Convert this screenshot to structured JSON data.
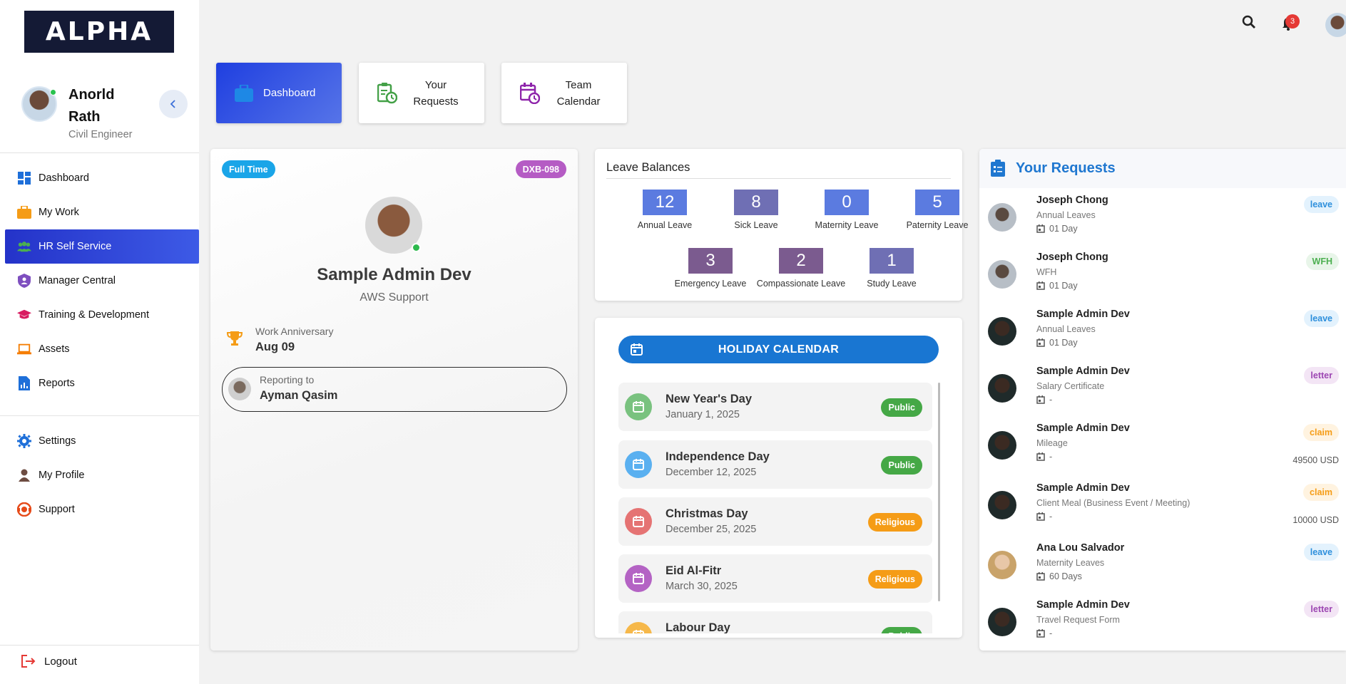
{
  "app": {
    "logo_text": "ALPHA"
  },
  "user": {
    "name": "Anorld Rath",
    "role": "Civil Engineer"
  },
  "sidebar": {
    "items": [
      {
        "label": "Dashboard",
        "icon": "dashboard-icon"
      },
      {
        "label": "My Work",
        "icon": "briefcase-icon"
      },
      {
        "label": "HR Self Service",
        "icon": "people-icon"
      },
      {
        "label": "Manager Central",
        "icon": "shield-icon"
      },
      {
        "label": "Training & Development",
        "icon": "graduation-cap-icon"
      },
      {
        "label": "Assets",
        "icon": "laptop-icon"
      },
      {
        "label": "Reports",
        "icon": "report-icon"
      }
    ],
    "secondary": [
      {
        "label": "Settings",
        "icon": "gear-icon"
      },
      {
        "label": "My Profile",
        "icon": "person-icon"
      },
      {
        "label": "Support",
        "icon": "support-icon"
      }
    ],
    "logout_label": "Logout",
    "active_index": 2
  },
  "topbar": {
    "notification_count": "3"
  },
  "tabs": [
    {
      "label": "Dashboard"
    },
    {
      "label": "Your Requests"
    },
    {
      "label": "Team Calendar"
    }
  ],
  "profile_card": {
    "employment_type": "Full Time",
    "employee_id": "DXB-098",
    "name": "Sample Admin Dev",
    "department": "AWS Support",
    "anniversary_label": "Work Anniversary",
    "anniversary_value": "Aug 09",
    "reporting_label": "Reporting to",
    "reporting_name": "Ayman Qasim"
  },
  "leave_balances": {
    "title": "Leave Balances",
    "items": [
      {
        "value": "12",
        "label": "Annual Leave",
        "color": "#5b7be0"
      },
      {
        "value": "8",
        "label": "Sick Leave",
        "color": "#6f6fb4"
      },
      {
        "value": "0",
        "label": "Maternity Leave",
        "color": "#5b7be0"
      },
      {
        "value": "5",
        "label": "Paternity Leave",
        "color": "#5b7be0"
      },
      {
        "value": "3",
        "label": "Emergency Leave",
        "color": "#7b5b8f"
      },
      {
        "value": "2",
        "label": "Compassionate Leave",
        "color": "#7b5b8f"
      },
      {
        "value": "1",
        "label": "Study Leave",
        "color": "#6f6fb4"
      }
    ]
  },
  "holiday_calendar": {
    "title": "HOLIDAY CALENDAR",
    "items": [
      {
        "name": "New Year's Day",
        "date": "January 1, 2025",
        "tag": "Public",
        "icon_color": "#79c27f",
        "tag_color": "#45a846"
      },
      {
        "name": "Independence Day",
        "date": "December 12, 2025",
        "tag": "Public",
        "icon_color": "#5ab0f0",
        "tag_color": "#45a846"
      },
      {
        "name": "Christmas Day",
        "date": "December 25, 2025",
        "tag": "Religious",
        "icon_color": "#e57373",
        "tag_color": "#f59c16"
      },
      {
        "name": "Eid Al-Fitr",
        "date": "March 30, 2025",
        "tag": "Religious",
        "icon_color": "#b463c4",
        "tag_color": "#f59c16"
      },
      {
        "name": "Labour Day",
        "date": "",
        "tag": "Public",
        "icon_color": "#f6b84a",
        "tag_color": "#45a846"
      }
    ]
  },
  "requests": {
    "title": "Your Requests",
    "items": [
      {
        "name": "Joseph Chong",
        "type": "Annual Leaves",
        "duration": "01 Day",
        "badge": "leave",
        "amount": "",
        "avatar": "male"
      },
      {
        "name": "Joseph Chong",
        "type": "WFH",
        "duration": "01 Day",
        "badge": "WFH",
        "amount": "",
        "avatar": "male"
      },
      {
        "name": "Sample Admin Dev",
        "type": "Annual Leaves",
        "duration": "01 Day",
        "badge": "leave",
        "amount": "",
        "avatar": "dark"
      },
      {
        "name": "Sample Admin Dev",
        "type": "Salary Certificate",
        "duration": "-",
        "badge": "letter",
        "amount": "",
        "avatar": "dark"
      },
      {
        "name": "Sample Admin Dev",
        "type": "Mileage",
        "duration": "-",
        "badge": "claim",
        "amount": "49500 USD",
        "avatar": "dark"
      },
      {
        "name": "Sample Admin Dev",
        "type": "Client Meal (Business Event / Meeting)",
        "duration": "-",
        "badge": "claim",
        "amount": "10000 USD",
        "avatar": "dark"
      },
      {
        "name": "Ana Lou Salvador",
        "type": "Maternity Leaves",
        "duration": "60 Days",
        "badge": "leave",
        "amount": "",
        "avatar": "female"
      },
      {
        "name": "Sample Admin Dev",
        "type": "Travel Request Form",
        "duration": "-",
        "badge": "letter",
        "amount": "",
        "avatar": "dark"
      }
    ]
  },
  "badge_colors": {
    "leave": {
      "bg": "#e3f2fd",
      "fg": "#2d8fdc"
    },
    "WFH": {
      "bg": "#e8f5e9",
      "fg": "#4caf50"
    },
    "letter": {
      "bg": "#f3e5f5",
      "fg": "#9c46b2"
    },
    "claim": {
      "bg": "#fff3e0",
      "fg": "#f59c16"
    }
  },
  "colors": {
    "primary": "#1976d2",
    "active_nav": "#2433c9",
    "full_time_pill": "#1aa5e8",
    "id_pill": "#b55cc4"
  }
}
